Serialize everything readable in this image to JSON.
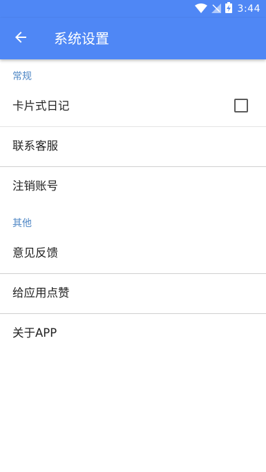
{
  "status_bar": {
    "time": "3:44",
    "icons": [
      "wifi-icon",
      "signal-icon",
      "battery-icon"
    ]
  },
  "app_bar": {
    "title": "系统设置",
    "back_icon": "arrow-back-icon",
    "color": "#4f87f5"
  },
  "sections": [
    {
      "header": "常规",
      "items": [
        {
          "label": "卡片式日记",
          "checked": false
        },
        {
          "label": "联系客服"
        },
        {
          "label": "注销账号"
        }
      ]
    },
    {
      "header": "其他",
      "items": [
        {
          "label": "意见反馈"
        },
        {
          "label": "给应用点赞"
        },
        {
          "label": "关于APP"
        }
      ]
    }
  ],
  "accent_color": "#4f87c5"
}
